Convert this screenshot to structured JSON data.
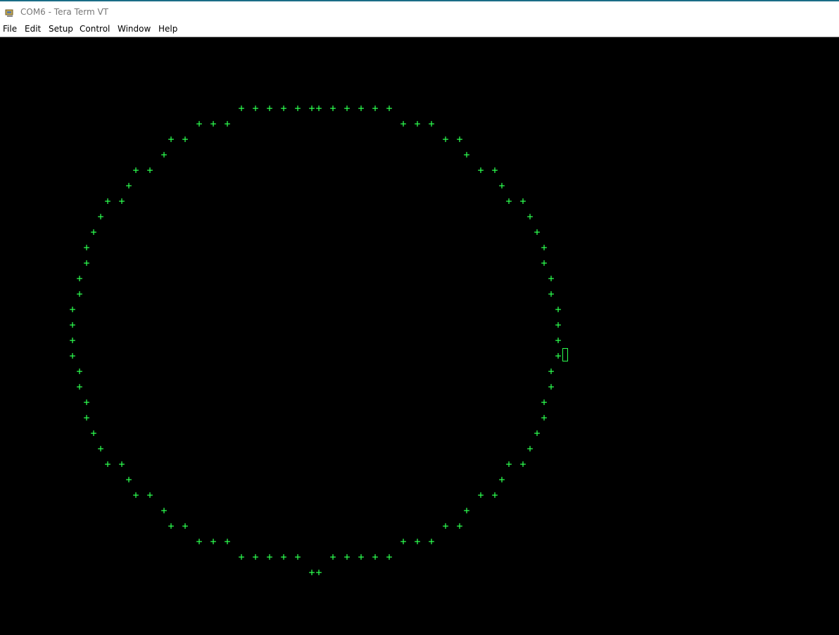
{
  "window": {
    "title": "COM6 - Tera Term VT",
    "icon": "tera-term-icon"
  },
  "menu": {
    "items": [
      {
        "label": "File"
      },
      {
        "label": "Edit"
      },
      {
        "label": "Setup"
      },
      {
        "label": "Control"
      },
      {
        "label": "Window"
      },
      {
        "label": "Help"
      }
    ]
  },
  "terminal": {
    "glyph": "+",
    "text_color": "#2cff4f",
    "background_color": "#000000",
    "cursor_style": "block-outline"
  }
}
